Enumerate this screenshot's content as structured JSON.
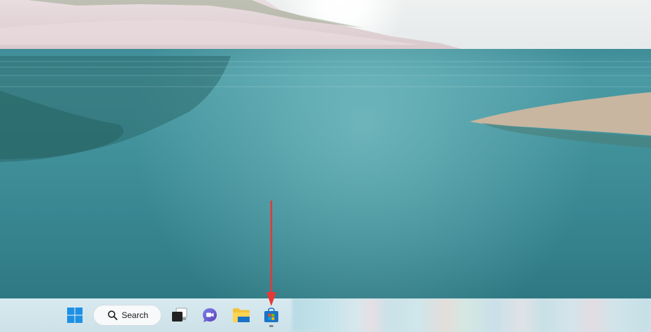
{
  "taskbar": {
    "start": {
      "icon": "windows-logo-icon"
    },
    "search": {
      "label": "Search",
      "icon": "search-icon"
    },
    "task_view": {
      "icon": "task-view-icon"
    },
    "chat": {
      "icon": "teams-chat-icon"
    },
    "file_explorer": {
      "icon": "folder-icon"
    },
    "store": {
      "icon": "microsoft-store-icon",
      "running": true
    }
  },
  "annotation": {
    "icon": "red-arrow-icon",
    "color": "#e53935"
  },
  "colors": {
    "windows_blue": "#1e90e6",
    "teams_purple": "#5b5fc7",
    "folder_yellow": "#f4c33a",
    "store_blue": "#1a73c8"
  }
}
